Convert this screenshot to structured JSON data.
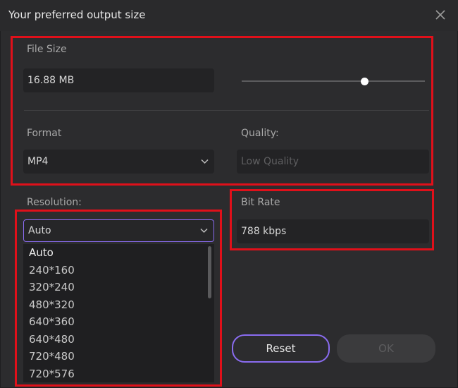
{
  "window": {
    "title": "Your preferred output size"
  },
  "file_size": {
    "label": "File Size",
    "value": "16.88 MB",
    "slider_fraction": 0.67
  },
  "format": {
    "label": "Format",
    "value": "MP4"
  },
  "quality": {
    "label": "Quality:",
    "value": "Low Quality"
  },
  "resolution": {
    "label": "Resolution:",
    "value": "Auto",
    "options": [
      "Auto",
      "240*160",
      "320*240",
      "480*320",
      "640*360",
      "640*480",
      "720*480",
      "720*576"
    ]
  },
  "bit_rate": {
    "label": "Bit Rate",
    "value": "788 kbps"
  },
  "buttons": {
    "reset": "Reset",
    "ok": "OK"
  },
  "colors": {
    "accent": "#8a6cf0",
    "highlight_box": "#e0101a",
    "background": "#2c2c2e"
  }
}
